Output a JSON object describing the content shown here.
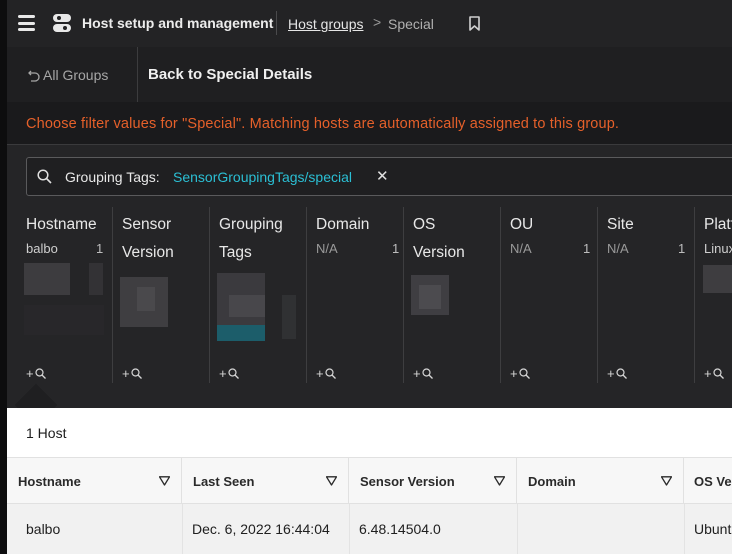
{
  "topbar": {
    "app_title": "Host setup and management",
    "breadcrumb_parent": "Host groups",
    "breadcrumb_separator": ">",
    "breadcrumb_current": "Special"
  },
  "nav": {
    "all_groups": "All Groups",
    "back_details": "Back to Special Details"
  },
  "notice": "Choose filter values for \"Special\". Matching hosts are automatically assigned to this group.",
  "search": {
    "label": "Grouping Tags:",
    "value": "SensorGroupingTags/special",
    "clear": "✕"
  },
  "filter_columns": [
    {
      "header": "Hostname",
      "value": "balbo",
      "count": "1",
      "add": "+"
    },
    {
      "header": "Sensor\nVersion",
      "value": "",
      "count": "",
      "add": "+"
    },
    {
      "header": "Grouping\nTags",
      "value": "",
      "count": "",
      "add": "+"
    },
    {
      "header": "Domain",
      "value": "N/A",
      "count": "1",
      "add": "+"
    },
    {
      "header": "OS\nVersion",
      "value": "",
      "count": "",
      "add": "+"
    },
    {
      "header": "OU",
      "value": "N/A",
      "count": "1",
      "add": "+"
    },
    {
      "header": "Site",
      "value": "N/A",
      "count": "1",
      "add": "+"
    },
    {
      "header": "Platform",
      "value": "Linux",
      "count": "",
      "add": "+"
    }
  ],
  "results": {
    "count_label": "1 Host",
    "columns": [
      "Hostname",
      "Last Seen",
      "Sensor Version",
      "Domain",
      "OS Version"
    ],
    "rows": [
      [
        "balbo",
        "Dec. 6, 2022 16:44:04",
        "6.48.14504.0",
        "",
        "Ubuntu"
      ]
    ]
  },
  "colors": {
    "accent_orange": "#e5602a",
    "tag_cyan": "#2bbfd4",
    "topbar_bg": "#232325",
    "panel_bg": "#252527"
  },
  "icons": [
    "menu-icon",
    "app-logo-icon",
    "bookmark-icon",
    "undo-arrow-icon",
    "search-icon",
    "clear-icon",
    "magnifier-icon",
    "filter-funnel-icon"
  ]
}
